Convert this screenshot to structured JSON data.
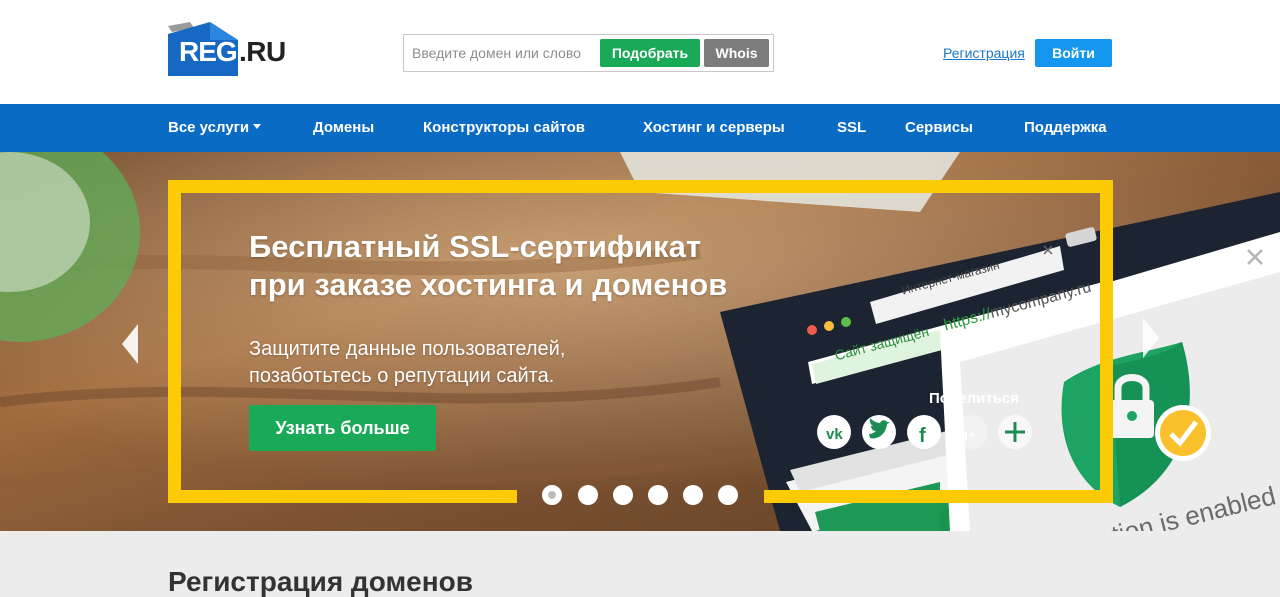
{
  "header": {
    "logo_left": "REG",
    "logo_right": ".RU",
    "search_placeholder": "Введите домен или слово",
    "pick_label": "Подобрать",
    "whois_label": "Whois",
    "register_link": "Регистрация",
    "login_label": "Войти"
  },
  "nav": {
    "items": [
      {
        "label": "Все услуги"
      },
      {
        "label": "Домены"
      },
      {
        "label": "Конструкторы сайтов"
      },
      {
        "label": "Хостинг и серверы"
      },
      {
        "label": "SSL"
      },
      {
        "label": "Сервисы"
      },
      {
        "label": "Поддержка"
      }
    ]
  },
  "banner": {
    "title_line1": "Бесплатный SSL-сертификат",
    "title_line2": "при заказе хостинга и доменов",
    "subtitle_line1": "Защитите данные пользователей,",
    "subtitle_line2": "позаботьтесь о репутации сайта.",
    "cta_label": "Узнать больше",
    "slide_count": 6,
    "active_slide": 1,
    "illustration": {
      "tab_title": "Интернет-магазин",
      "secure_label": "Сайт защищён",
      "url_scheme": "https://",
      "url_host": "mycompany.ru",
      "share_label": "Поделиться",
      "caption_partial": "ction is enabled"
    }
  },
  "section": {
    "title": "Регистрация доменов"
  },
  "colors": {
    "brand_blue": "#0a6bc4",
    "accent_green": "#1aa957",
    "frame_yellow": "#fccb05",
    "login_blue": "#1597ef"
  }
}
